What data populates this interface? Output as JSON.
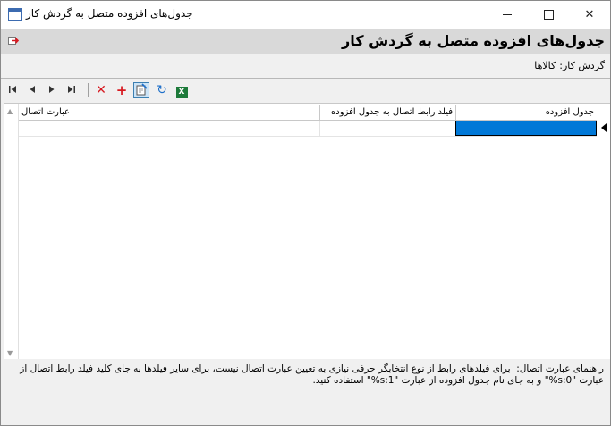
{
  "window": {
    "title": "جدول‌های افزوده متصل به گردش کار"
  },
  "header": {
    "title": "جدول‌های افزوده متصل به گردش کار"
  },
  "process": {
    "label": "گردش کار:",
    "value": "کالاها"
  },
  "toolbar": {
    "first": "⏮",
    "prev": "◀",
    "next": "▶",
    "last": "⏭",
    "delete": "✕",
    "add": "+",
    "refresh": "↻",
    "excel": "X"
  },
  "grid": {
    "columns": [
      "جدول افزوده",
      "فیلد رابط اتصال به جدول افزوده",
      "عبارت اتصال"
    ],
    "rows": [
      {
        "table": "",
        "field": "",
        "expression": ""
      }
    ]
  },
  "help": {
    "text": "راهنمای عبارت اتصال:  برای فیلدهای رابط از نوع انتخابگر حرفی نیازی به تعیین عبارت اتصال نیست، برای سایر فیلدها به جای کلید فیلد رابط اتصال از\nعبارت \"0:s%\" و به جای نام جدول افزوده از عبارت \"1:s%\" استفاده کنید."
  }
}
